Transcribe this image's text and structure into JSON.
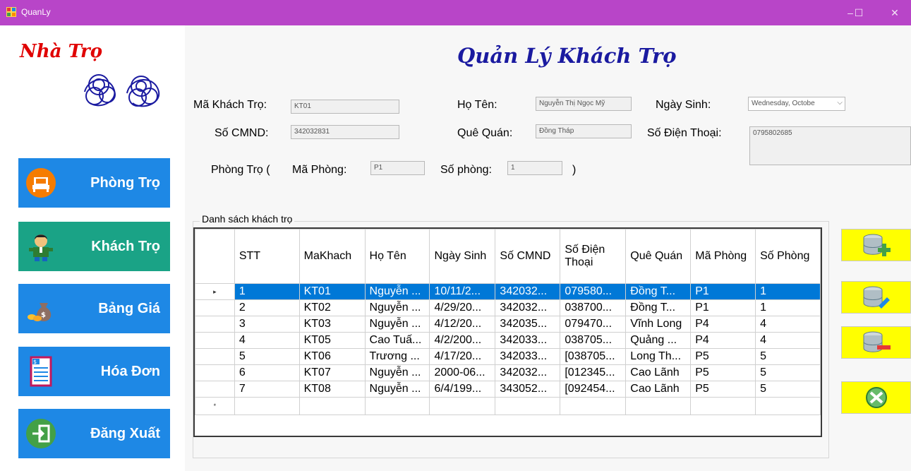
{
  "window": {
    "title": "QuanLy",
    "controls": [
      "–",
      "☐",
      "✕"
    ]
  },
  "sidebar": {
    "brand": "Nhà Trọ",
    "nav": [
      {
        "label": "Phòng Trọ",
        "icon": "sofa-icon",
        "color": "#1e88e5"
      },
      {
        "label": "Khách Trọ",
        "icon": "person-icon",
        "color": "#1aa386"
      },
      {
        "label": "Bảng Giá",
        "icon": "money-bag-icon",
        "color": "#1e88e5"
      },
      {
        "label": "Hóa Đơn",
        "icon": "invoice-icon",
        "color": "#1e88e5"
      },
      {
        "label": "Đăng Xuất",
        "icon": "logout-icon",
        "color": "#1e88e5"
      }
    ]
  },
  "main": {
    "title": "Quản Lý Khách Trọ"
  },
  "form": {
    "ma_khach_label": "Mã Khách Trọ:",
    "ma_khach_value": "KT01",
    "ho_ten_label": "Họ Tên:",
    "ho_ten_value": "Nguyễn Thị Ngọc Mỹ",
    "ngay_sinh_label": "Ngày Sinh:",
    "ngay_sinh_value": "Wednesday,  Octobe",
    "cmnd_label": "Số CMND:",
    "cmnd_value": "342032831",
    "que_quan_label": "Quê Quán:",
    "que_quan_value": "Đồng Tháp",
    "sdt_label": "Số Điện Thoại:",
    "sdt_value": "0795802685",
    "phong_tro_label": "Phòng Trọ (",
    "ma_phong_label": "Mã Phòng:",
    "ma_phong_value": "P1",
    "so_phong_label": "Số phòng:",
    "so_phong_value": "1",
    "close_paren": ")"
  },
  "table": {
    "group_title": "Danh sách khách trọ",
    "headers": [
      "STT",
      "MaKhach",
      "Họ Tên",
      "Ngày Sinh",
      "Số CMND",
      "Số Điện Thoại",
      "Quê Quán",
      "Mã Phòng",
      "Số Phòng"
    ],
    "rows": [
      [
        "1",
        "KT01",
        "Nguyễn ...",
        "10/11/2...",
        "342032...",
        "079580...",
        "Đồng T...",
        "P1",
        "1"
      ],
      [
        "2",
        "KT02",
        "Nguyễn ...",
        "4/29/20...",
        "342032...",
        "038700...",
        "Đồng T...",
        "P1",
        "1"
      ],
      [
        "3",
        "KT03",
        "Nguyễn ...",
        "4/12/20...",
        "342035...",
        "079470...",
        "Vĩnh Long",
        "P4",
        "4"
      ],
      [
        "4",
        "KT05",
        "Cao Tuấ...",
        "4/2/200...",
        "342033...",
        "038705...",
        "Quảng ...",
        "P4",
        "4"
      ],
      [
        "5",
        "KT06",
        "Trương ...",
        "4/17/20...",
        "342033...",
        "[038705...",
        "Long Th...",
        "P5",
        "5"
      ],
      [
        "6",
        "KT07",
        "Nguyễn ...",
        "2000-06...",
        "342032...",
        "[012345...",
        "Cao Lãnh",
        "P5",
        "5"
      ],
      [
        "7",
        "KT08",
        "Nguyễn ...",
        "6/4/199...",
        "343052...",
        "[092454...",
        "Cao Lãnh",
        "P5",
        "5"
      ]
    ],
    "current_row_marker": "▸",
    "new_row_marker": "*"
  },
  "actions": [
    {
      "name": "add-button",
      "icon": "database-add-icon"
    },
    {
      "name": "update-button",
      "icon": "database-edit-icon"
    },
    {
      "name": "delete-button",
      "icon": "database-remove-icon"
    },
    {
      "name": "exit-button",
      "icon": "tools-icon"
    }
  ]
}
